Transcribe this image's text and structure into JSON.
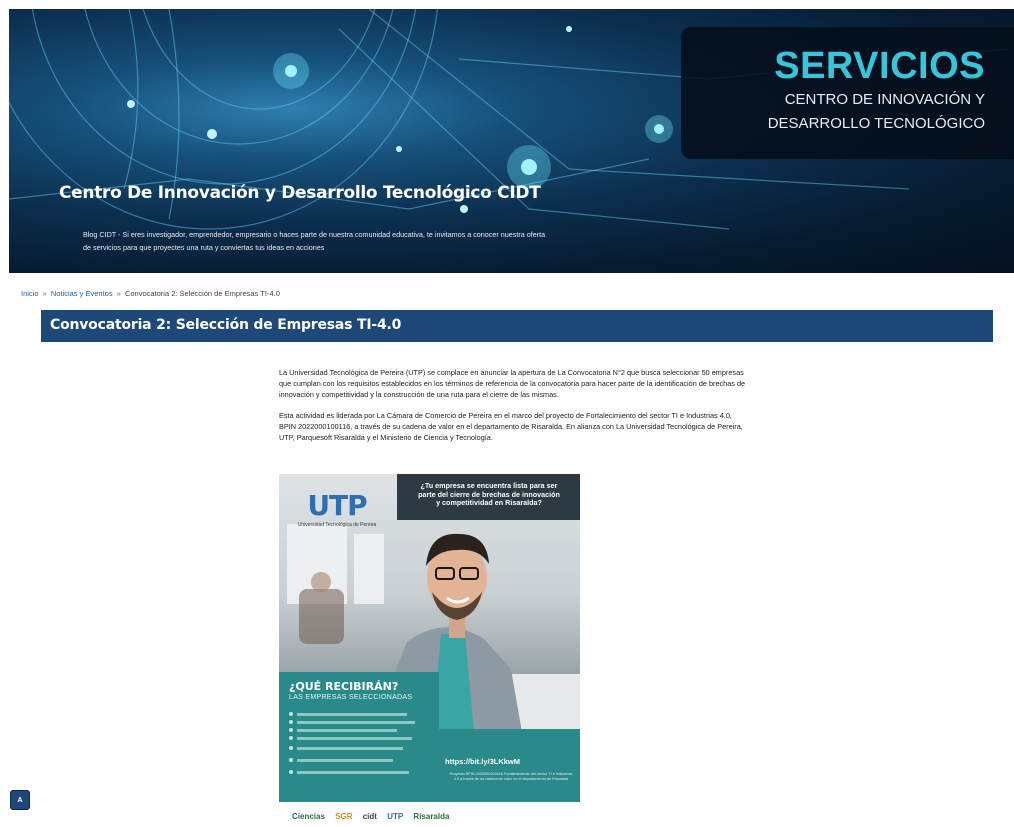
{
  "hero": {
    "panel_title": "SERVICIOS",
    "panel_sub_1": "CENTRO DE INNOVACIÓN Y",
    "panel_sub_2": "DESARROLLO TECNOLÓGICO",
    "title": "Centro De Innovación y Desarrollo Tecnológico CIDT",
    "description": "Blog CIDT - Si eres investigador, emprendedor, empresario o haces parte de nuestra comunidad educativa, te invitamos a conocer nuestra oferta de servicios para que proyectes una ruta y conviertas tus ideas en acciones"
  },
  "breadcrumb": {
    "home": "Inicio",
    "section": "Noticias y Eventos",
    "current": "Convocatoria 2: Selección de Empresas TI-4.0",
    "separator": "»"
  },
  "page": {
    "title": "Convocatoria 2: Selección de Empresas TI-4.0"
  },
  "article": {
    "paragraph_1": "La Universidad Tecnológica de Pereira (UTP) se complace en anunciar la apertura de La Convocatoria N°2 que busca seleccionar 50 empresas que cumplan con los requisitos establecidos en los términos de referencia de la convocatoria para hacer parte de la identificación de brechas de innovación y competitividad y la construcción de una ruta para el cierre de las mismas.",
    "paragraph_2": "Esta actividad es liderada por La Cámara de Comercio de Pereira en el marco del proyecto de Fortalecimiento del sector TI e Industrias 4.0, BPIN 2022000100116, a través de su cadena de valor en el departamento de Risaralda. En alianza con La Universidad Tecnológica de Pereira, UTP, Parquesoft Risaralda y el Ministerio de Ciencia y Tecnología."
  },
  "poster": {
    "headline_1": "¿Tu empresa se encuentra lista para ser",
    "headline_2": "parte del cierre de brechas de innovación",
    "headline_3": "y competitividad en Risaralda?",
    "logo_letters": "UTP",
    "logo_name": "Universidad Tecnológica de Pereira",
    "question": "¿QUÉ RECIBIRÁN?",
    "question_sub": "LAS EMPRESAS SELECCIONADAS",
    "link": "https://bit.ly/3LKkwM",
    "fine_print": "Proyecto BPIN 2022000100116 Fortalecimiento del sector TI e Industrias 4.0 a través de su cadena de valor en el departamento de Risaralda"
  },
  "logos": {
    "items": [
      "Ciencias",
      "SGR",
      "cidt",
      "UTP",
      "Risaralda"
    ]
  },
  "accessibility": {
    "label": "A"
  }
}
